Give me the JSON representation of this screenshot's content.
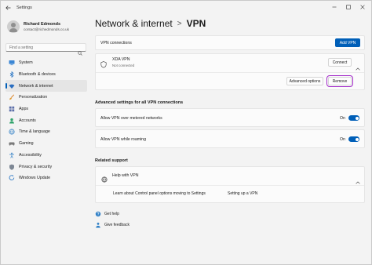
{
  "window": {
    "app_title": "Settings"
  },
  "profile": {
    "name": "Richard Edmonds",
    "email": "contact@richedmonds.co.uk"
  },
  "search": {
    "placeholder": "Find a setting"
  },
  "sidebar": {
    "items": [
      {
        "label": "System",
        "icon": "monitor-icon"
      },
      {
        "label": "Bluetooth & devices",
        "icon": "bluetooth-icon"
      },
      {
        "label": "Network & internet",
        "icon": "wifi-icon",
        "active": true
      },
      {
        "label": "Personalization",
        "icon": "brush-icon"
      },
      {
        "label": "Apps",
        "icon": "apps-icon"
      },
      {
        "label": "Accounts",
        "icon": "person-icon"
      },
      {
        "label": "Time & language",
        "icon": "globe-clock-icon"
      },
      {
        "label": "Gaming",
        "icon": "gamepad-icon"
      },
      {
        "label": "Accessibility",
        "icon": "accessibility-icon"
      },
      {
        "label": "Privacy & security",
        "icon": "shield-icon"
      },
      {
        "label": "Windows Update",
        "icon": "update-icon"
      }
    ]
  },
  "breadcrumb": {
    "parent": "Network & internet",
    "separator": ">",
    "current": "VPN"
  },
  "vpn": {
    "connections_label": "VPN connections",
    "add_vpn_label": "Add VPN",
    "entry_name": "XDA VPN",
    "entry_status": "Not connected",
    "connect_label": "Connect",
    "advanced_options_label": "Advanced options",
    "remove_label": "Remove"
  },
  "advanced": {
    "heading": "Advanced settings for all VPN connections",
    "metered": {
      "label": "Allow VPN over metered networks",
      "state": "On",
      "on": true
    },
    "roaming": {
      "label": "Allow VPN while roaming",
      "state": "On",
      "on": true
    }
  },
  "related": {
    "heading": "Related support",
    "help_title": "Help with VPN",
    "links": [
      "Learn about Control panel options moving to Settings",
      "Setting up a VPN"
    ]
  },
  "footer": {
    "get_help": "Get help",
    "give_feedback": "Give feedback"
  },
  "colors": {
    "accent": "#005fb8",
    "highlight": "#a22ac9"
  }
}
